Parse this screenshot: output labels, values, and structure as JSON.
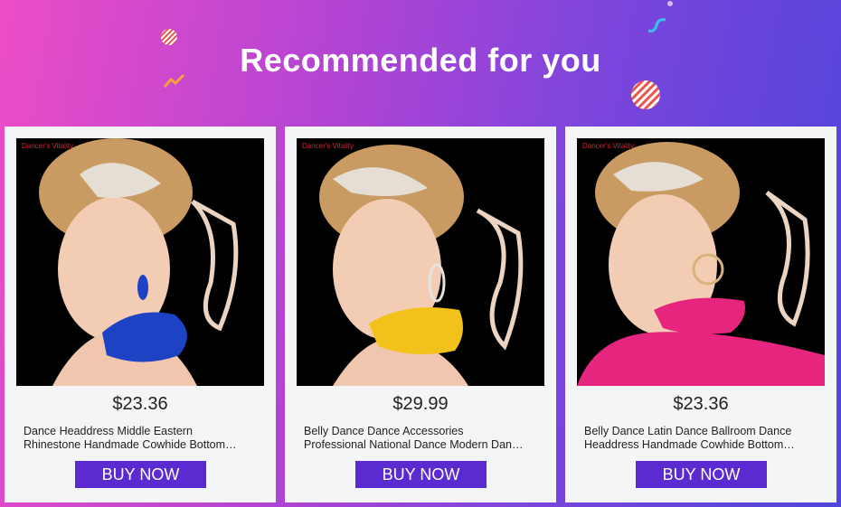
{
  "banner": {
    "title": "Recommended for you"
  },
  "colors": {
    "button": "#5b2ad0",
    "card_bg": "#f4f5f7",
    "brand_text": "#d8262b"
  },
  "products": [
    {
      "brand": "Dancer's Vitality",
      "price": "$23.36",
      "title_line1": "Dance Headdress Middle Eastern",
      "title_line2": "Rhinestone Handmade Cowhide Bottom…",
      "button": "BUY NOW",
      "accent": "#1d43c4"
    },
    {
      "brand": "Dancer's Vitality",
      "price": "$29.99",
      "title_line1": "Belly Dance Dance Accessories",
      "title_line2": "Professional National Dance Modern Dan…",
      "button": "BUY NOW",
      "accent": "#f2c21a"
    },
    {
      "brand": "Dancer's Vitality",
      "price": "$23.36",
      "title_line1": "Belly Dance Latin Dance Ballroom Dance",
      "title_line2": "Headdress Handmade Cowhide Bottom…",
      "button": "BUY NOW",
      "accent": "#e5257e"
    }
  ]
}
